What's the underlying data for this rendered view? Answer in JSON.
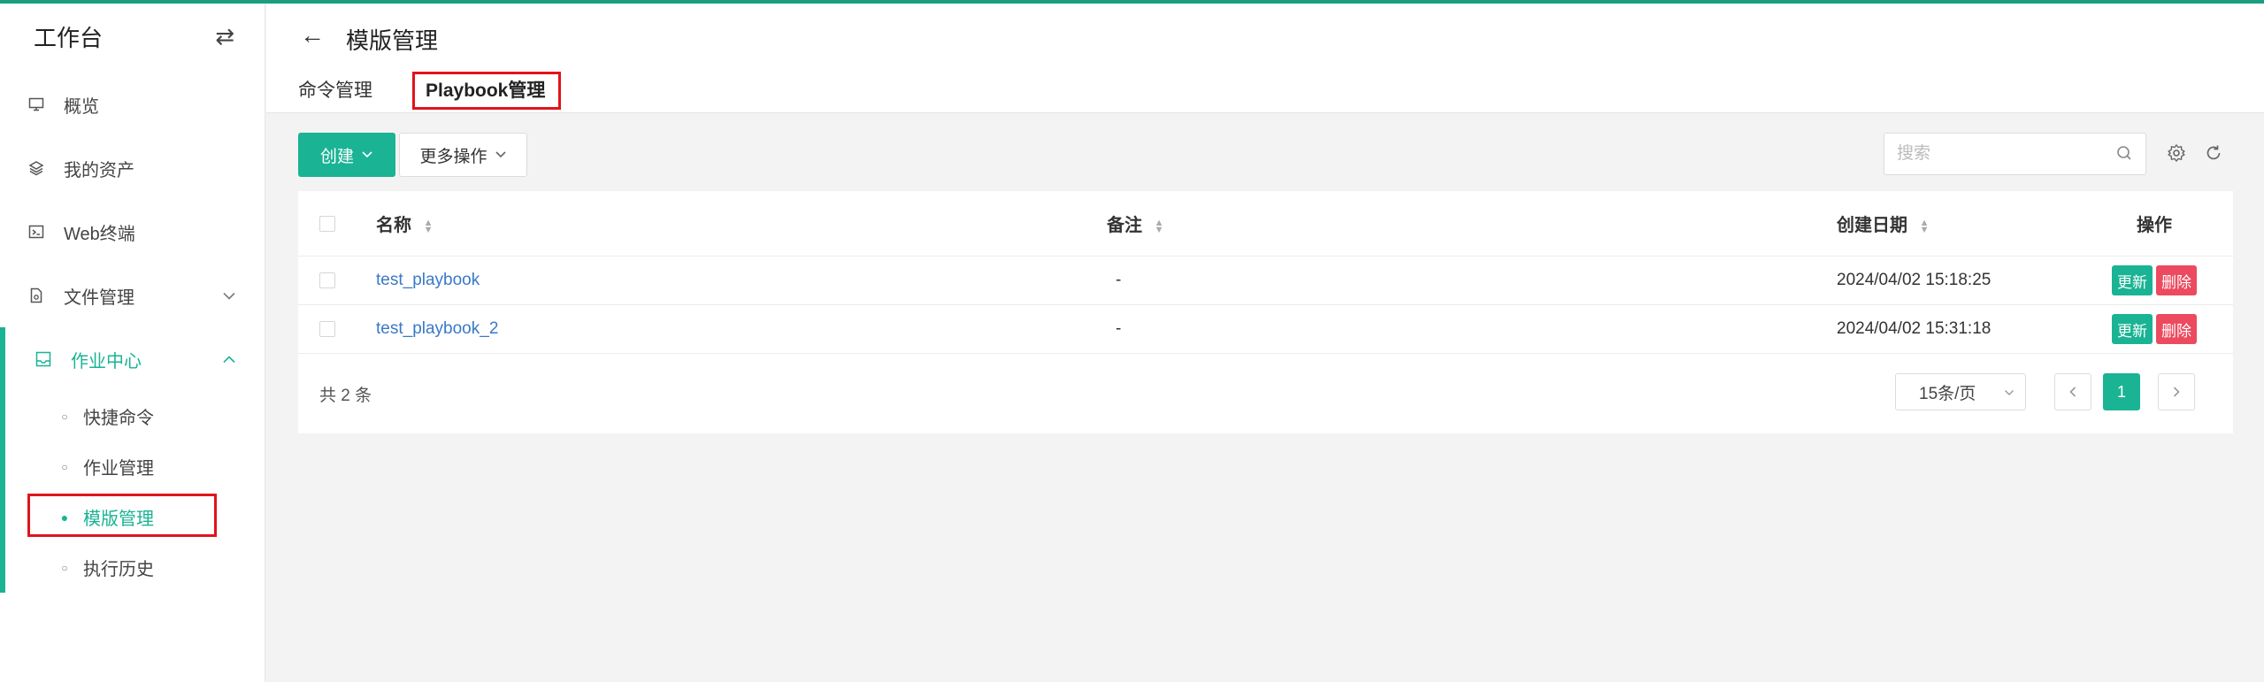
{
  "sidebar": {
    "title": "工作台",
    "swap_icon": "swap-icon",
    "items": [
      {
        "label": "概览",
        "icon": "monitor-icon"
      },
      {
        "label": "我的资产",
        "icon": "layers-icon"
      },
      {
        "label": "Web终端",
        "icon": "terminal-icon"
      },
      {
        "label": "文件管理",
        "icon": "file-icon"
      }
    ],
    "job_center": {
      "label": "作业中心",
      "icon": "task-icon",
      "subitems": [
        {
          "label": "快捷命令"
        },
        {
          "label": "作业管理"
        },
        {
          "label": "模版管理"
        },
        {
          "label": "执行历史"
        }
      ]
    }
  },
  "header": {
    "title": "模版管理",
    "tabs": [
      {
        "label": "命令管理"
      },
      {
        "label": "Playbook管理"
      }
    ]
  },
  "toolbar": {
    "create_label": "创建",
    "more_label": "更多操作",
    "search_placeholder": "搜索"
  },
  "table": {
    "columns": {
      "name": "名称",
      "remark": "备注",
      "date": "创建日期",
      "ops": "操作"
    },
    "rows": [
      {
        "name": "test_playbook",
        "remark": "-",
        "date": "2024/04/02 15:18:25",
        "update": "更新",
        "delete": "删除"
      },
      {
        "name": "test_playbook_2",
        "remark": "-",
        "date": "2024/04/02 15:31:18",
        "update": "更新",
        "delete": "删除"
      }
    ]
  },
  "pagination": {
    "total_text": "共 2 条",
    "page_size": "15条/页",
    "current_page": "1"
  },
  "colors": {
    "accent": "#1ab394",
    "danger": "#ec4a5e",
    "link": "#3a78c8",
    "highlight": "#e2131b"
  }
}
